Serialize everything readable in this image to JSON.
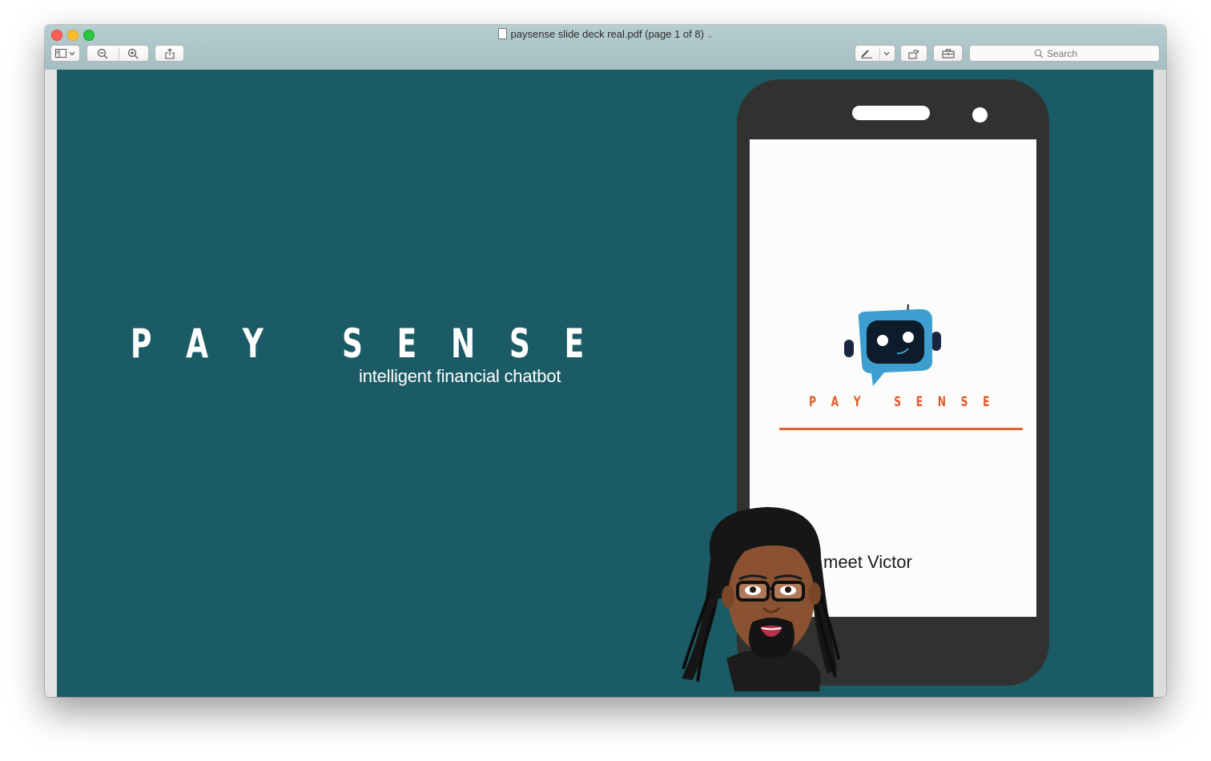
{
  "window": {
    "title": "paysense slide deck real.pdf (page 1 of 8)"
  },
  "toolbar": {
    "search_placeholder": "Search",
    "icons": [
      "sidebar-icon",
      "zoom-out-icon",
      "zoom-in-icon",
      "share-icon",
      "markup-icon",
      "rotate-icon",
      "toolbox-icon",
      "search-icon"
    ]
  },
  "slide": {
    "brand": "P A Y   S E N S E",
    "tagline": "intelligent financial chatbot",
    "phone_brand": "P A Y   S E N S E",
    "meet_text": "meet Victor"
  },
  "colors": {
    "slide_bg": "#1b5b65",
    "phone_body": "#313130",
    "accent_orange": "#e05c2c",
    "robot_blue": "#3d9fd0"
  }
}
